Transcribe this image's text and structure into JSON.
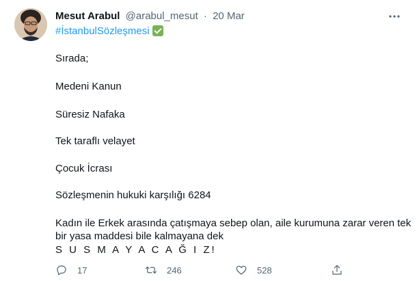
{
  "tweet": {
    "author_name": "Mesut Arabul",
    "handle": "@arabul_mesut",
    "separator": "·",
    "date": "20 Mar",
    "hashtag": "#İstanbulSözleşmesi",
    "lines": [
      "Sırada;",
      "Medeni Kanun",
      "Süresiz Nafaka",
      "Tek taraflı velayet",
      "Çocuk İcrası",
      "Sözleşmenin hukuki karşılığı 6284",
      "Kadın ile Erkek arasında çatışmaya sebep olan, aile kurumuna zarar veren tek",
      "bir yasa maddesi bile kalmayana dek",
      "S U S M A Y A C A Ğ I Z!"
    ],
    "actions": {
      "reply_count": "17",
      "retweet_count": "246",
      "like_count": "528"
    }
  },
  "icons": {
    "more": "more-horizontal-icon",
    "check": "check-mark-emoji-icon",
    "reply": "reply-icon",
    "retweet": "retweet-icon",
    "like": "heart-icon",
    "share": "share-icon"
  },
  "colors": {
    "link": "#1d9bf0",
    "muted": "#536471",
    "text": "#0f1419",
    "check_green": "#77b255"
  }
}
